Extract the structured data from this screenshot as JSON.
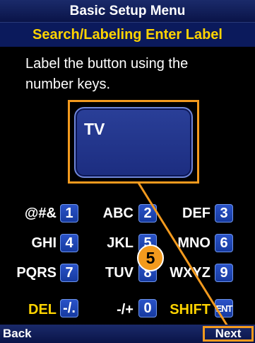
{
  "header": {
    "title": "Basic Setup Menu"
  },
  "subheader": {
    "title": "Search/Labeling Enter Label"
  },
  "instruction": "Label the button using the number keys.",
  "label_field": {
    "value": "TV"
  },
  "keypad": {
    "rows": [
      [
        {
          "label": "@#&",
          "key": "1"
        },
        {
          "label": "ABC",
          "key": "2"
        },
        {
          "label": "DEF",
          "key": "3"
        }
      ],
      [
        {
          "label": "GHI",
          "key": "4"
        },
        {
          "label": "JKL",
          "key": "5"
        },
        {
          "label": "MNO",
          "key": "6"
        }
      ],
      [
        {
          "label": "PQRS",
          "key": "7"
        },
        {
          "label": "TUV",
          "key": "8"
        },
        {
          "label": "WXYZ",
          "key": "9"
        }
      ],
      [
        {
          "label": "DEL",
          "key": "-/."
        },
        {
          "label": "-/+",
          "key": "0"
        },
        {
          "label": "SHIFT",
          "key": "ENT"
        }
      ]
    ]
  },
  "footer": {
    "back_label": "Back",
    "next_label": "Next"
  },
  "callout": {
    "number": "5"
  },
  "colors": {
    "accent": "#f39a1e",
    "highlight_text": "#ffd400",
    "bar": "#0b1a5c",
    "key": "#1f4bbd"
  }
}
